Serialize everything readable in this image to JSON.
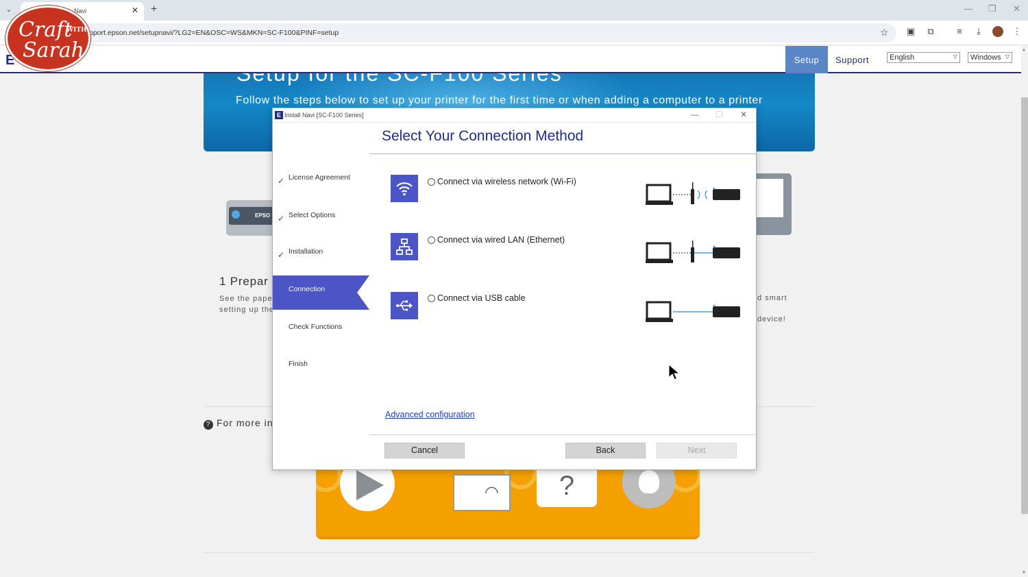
{
  "browser": {
    "tab_title": "Navi",
    "url": "pport.epson.net/setupnavi/?LG2=EN&OSC=WS&MKN=SC-F100&PINF=setup"
  },
  "logo": {
    "line1": "Craft",
    "with": "WITH",
    "line2": "Sarah"
  },
  "site": {
    "brand": "E",
    "nav_setup": "Setup",
    "nav_support": "Support",
    "language": "English",
    "os": "Windows",
    "hero_title": "Setup for the SC-F100 Series",
    "hero_text": "Follow the steps below to set up your printer for the first time or when adding a computer to a printer",
    "printer_brand": "EPSO",
    "step_title": "1 Prepar",
    "step_text_1": "See the pape",
    "step_text_2": "setting up the",
    "right_text_1": "d smart",
    "right_text_2": "device!",
    "more_info": "For more in"
  },
  "dialog": {
    "title": "Install Navi [SC-F100 Series]",
    "heading": "Select Your Connection Method",
    "steps": [
      {
        "label": "License Agreement",
        "done": true
      },
      {
        "label": "Select Options",
        "done": true
      },
      {
        "label": "Installation",
        "done": true
      },
      {
        "label": "Connection",
        "active": true
      },
      {
        "label": "Check Functions"
      },
      {
        "label": "Finish"
      }
    ],
    "options": [
      {
        "label": "Connect via wireless network (Wi-Fi)",
        "icon": "wifi-icon"
      },
      {
        "label": "Connect via wired LAN (Ethernet)",
        "icon": "network-icon"
      },
      {
        "label": "Connect via USB cable",
        "icon": "usb-icon"
      }
    ],
    "advanced_link": "Advanced configuration",
    "cancel": "Cancel",
    "back": "Back",
    "next": "Next"
  },
  "colors": {
    "epson_blue": "#1d2d88",
    "accent": "#4b55c5"
  }
}
